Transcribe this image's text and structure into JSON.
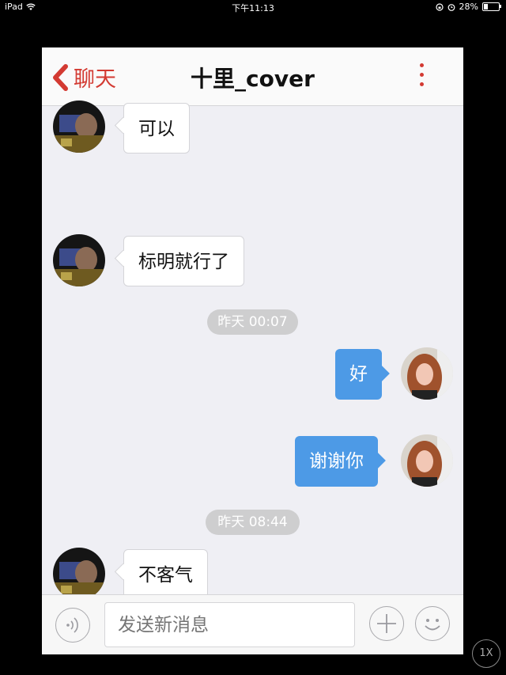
{
  "status_bar": {
    "device": "iPad",
    "time": "下午11:13",
    "battery": "28%"
  },
  "navbar": {
    "back_label": "聊天",
    "title": "十里_cover",
    "more_icon": "more-vertical-icon"
  },
  "messages": [
    {
      "direction": "in",
      "text": "可以"
    },
    {
      "direction": "in",
      "text": "标明就行了"
    },
    {
      "type": "time",
      "text": "昨天 00:07"
    },
    {
      "direction": "out",
      "text": "好"
    },
    {
      "direction": "out",
      "text": "谢谢你"
    },
    {
      "type": "time",
      "text": "昨天 08:44"
    },
    {
      "direction": "in",
      "text": "不客气"
    }
  ],
  "input_bar": {
    "placeholder": "发送新消息",
    "voice_icon": "voice-icon",
    "plus_icon": "plus-icon",
    "emoji_icon": "emoji-icon"
  },
  "zoom_button": "1X",
  "colors": {
    "accent": "#d33a32",
    "outgoing_bubble": "#4d9ae6",
    "background": "#efeff4"
  }
}
